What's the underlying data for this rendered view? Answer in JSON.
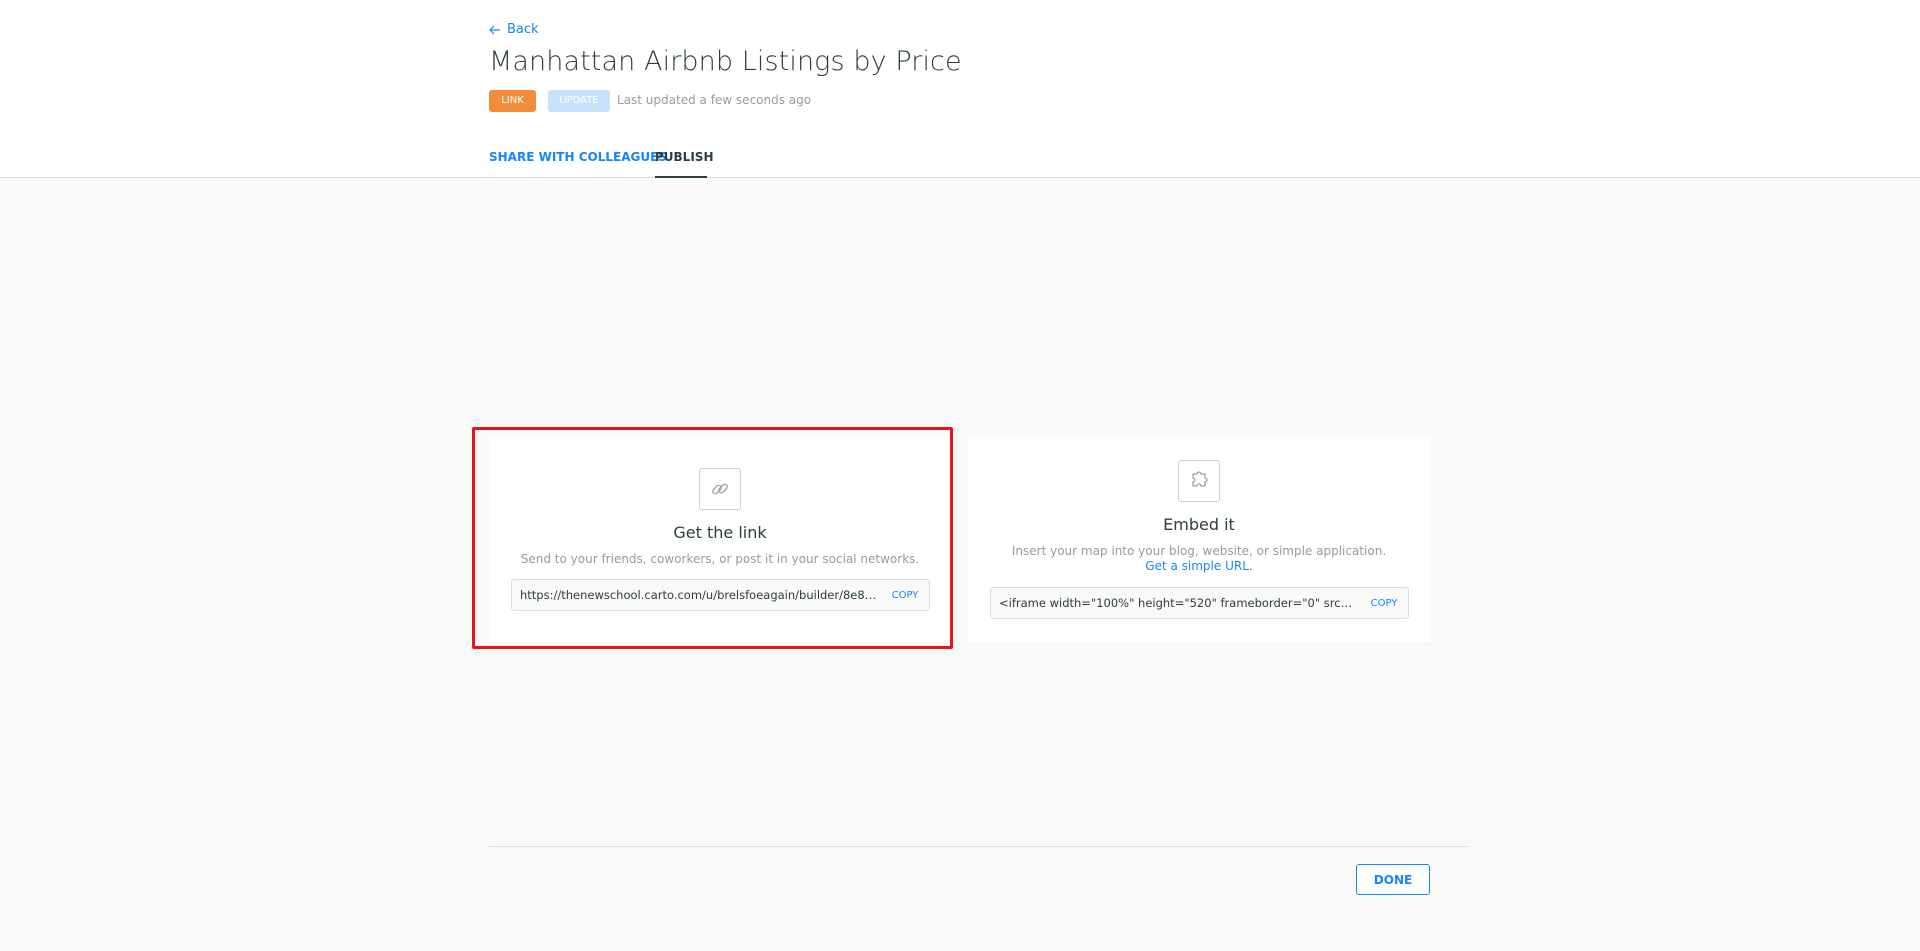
{
  "header": {
    "back_label": "Back",
    "title": "Manhattan Airbnb Listings by Price",
    "badge_link": "LINK",
    "badge_update": "UPDATE",
    "last_updated": "Last updated a few seconds ago"
  },
  "tabs": [
    {
      "label": "SHARE WITH COLLEAGUES",
      "active": false
    },
    {
      "label": "PUBLISH",
      "active": true
    }
  ],
  "cards": {
    "link": {
      "icon": "link-icon",
      "title": "Get the link",
      "description": "Send to your friends, coworkers, or post it in your social networks.",
      "value": "https://thenewschool.carto.com/u/brelsfoeagain/builder/8e887 ...",
      "copy_label": "COPY"
    },
    "embed": {
      "icon": "puzzle-icon",
      "title": "Embed it",
      "description": "Insert your map into your blog, website, or simple application.",
      "simple_url_label": "Get a simple URL.",
      "value": "<iframe width=\"100%\" height=\"520\" frameborder=\"0\" src=\"htt ...",
      "copy_label": "COPY"
    }
  },
  "footer": {
    "done_label": "DONE"
  },
  "colors": {
    "accent": "#1785fb",
    "badge_link": "#f08c3a",
    "badge_update": "#c8e2fd",
    "highlight": "#e8141c"
  }
}
